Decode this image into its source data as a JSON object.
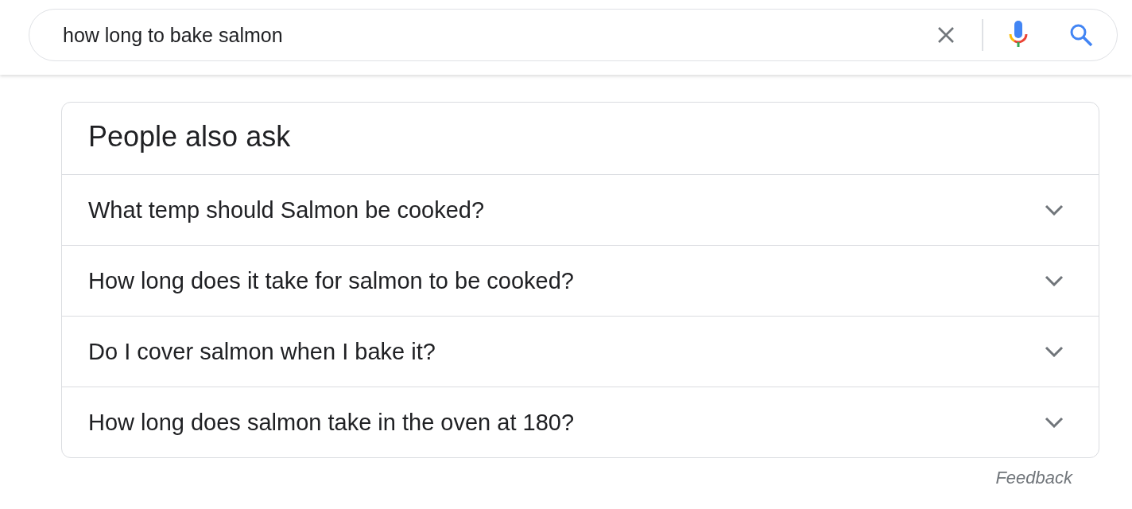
{
  "search": {
    "value": "how long to bake salmon"
  },
  "people_also_ask": {
    "title": "People also ask",
    "questions": [
      {
        "text": "What temp should Salmon be cooked?",
        "expanded": false
      },
      {
        "text": "How long does it take for salmon to be cooked?",
        "expanded": false
      },
      {
        "text": "Do I cover salmon when I bake it?",
        "expanded": false
      },
      {
        "text": "How long does salmon take in the oven at 180?",
        "expanded": false
      }
    ]
  },
  "feedback": "Feedback"
}
